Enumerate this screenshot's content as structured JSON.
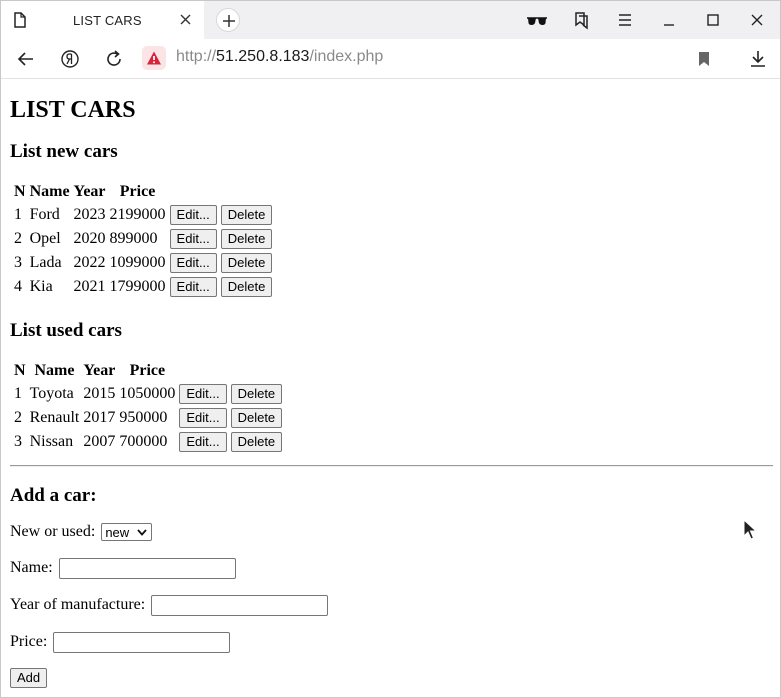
{
  "browser": {
    "tab_title": "LIST CARS",
    "url_scheme": "http://",
    "url_host": "51.250.8.183",
    "url_path": "/index.php"
  },
  "page": {
    "title": "LIST CARS",
    "new_section_title": "List new cars",
    "used_section_title": "List used cars",
    "columns": [
      "N",
      "Name",
      "Year",
      "Price"
    ],
    "edit_label": "Edit...",
    "delete_label": "Delete",
    "new_cars": [
      {
        "n": "1",
        "name": "Ford",
        "year": "2023",
        "price": "2199000"
      },
      {
        "n": "2",
        "name": "Opel",
        "year": "2020",
        "price": "899000"
      },
      {
        "n": "3",
        "name": "Lada",
        "year": "2022",
        "price": "1099000"
      },
      {
        "n": "4",
        "name": "Kia",
        "year": "2021",
        "price": "1799000"
      }
    ],
    "used_cars": [
      {
        "n": "1",
        "name": "Toyota",
        "year": "2015",
        "price": "1050000"
      },
      {
        "n": "2",
        "name": "Renault",
        "year": "2017",
        "price": "950000"
      },
      {
        "n": "3",
        "name": "Nissan",
        "year": "2007",
        "price": "700000"
      }
    ]
  },
  "form": {
    "title": "Add a car:",
    "type_label": "New or used:",
    "type_value": "new",
    "name_label": "Name:",
    "year_label": "Year of manufacture:",
    "price_label": "Price:",
    "submit_label": "Add"
  }
}
